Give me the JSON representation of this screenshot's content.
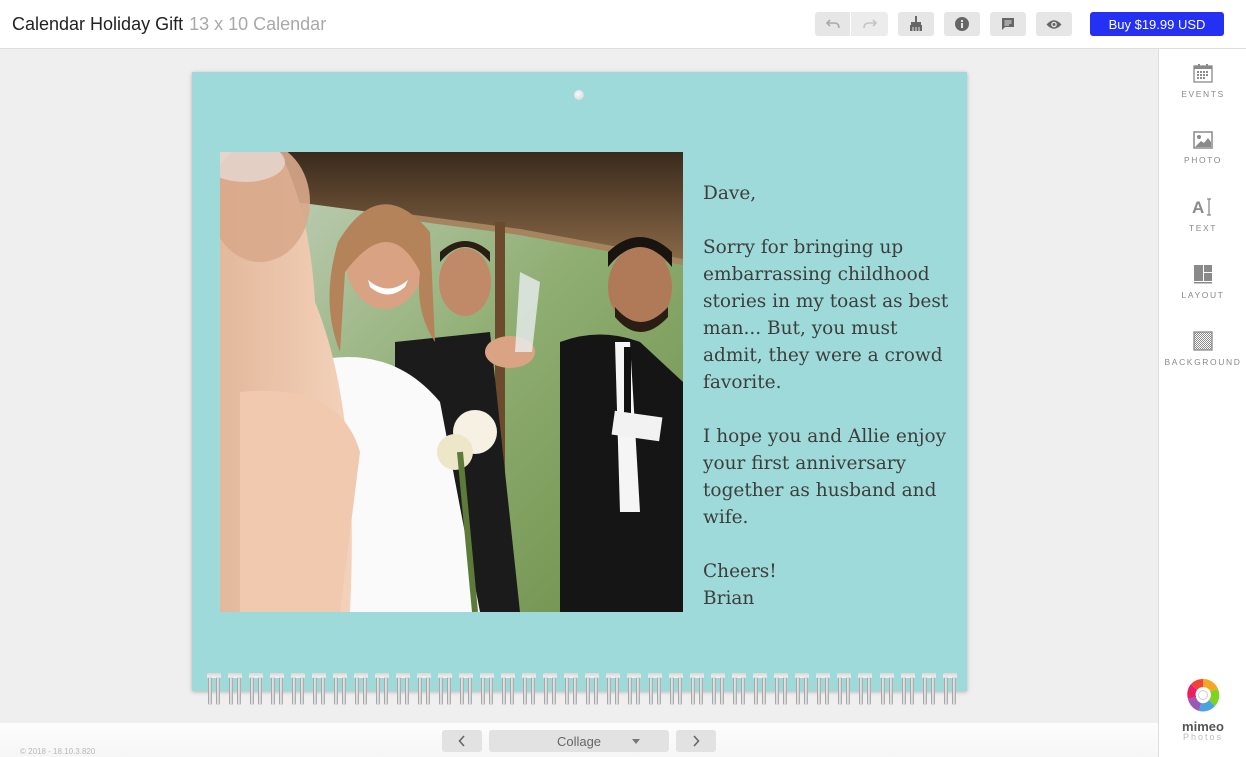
{
  "header": {
    "title": "Calendar Holiday Gift",
    "subtitle": "13 x 10 Calendar",
    "toolbar": {
      "undo_icon": "undo-icon",
      "redo_icon": "redo-icon",
      "clean_icon": "brush-icon",
      "info_icon": "info-icon",
      "comment_icon": "comment-icon",
      "preview_icon": "eye-icon"
    },
    "buy_label": "Buy $19.99 USD",
    "buy_color": "#2431f5"
  },
  "page": {
    "background_color": "#9edada",
    "photo_description": "Wedding toast: bride smiling holding a champagne glass beside groom and best man under a pergola",
    "message": {
      "greeting": "Dave,",
      "paragraph1": "Sorry for bringing up embarrassing childhood stories in my toast as best man... But, you must admit, they were a crowd favorite.",
      "paragraph2": "I hope you and Allie enjoy your first anniversary together as husband and wife.",
      "closing": "Cheers!",
      "signature": "Brian"
    }
  },
  "sidebar": {
    "items": [
      {
        "label": "EVENTS",
        "icon": "calendar-icon"
      },
      {
        "label": "PHOTO",
        "icon": "photo-icon"
      },
      {
        "label": "TEXT",
        "icon": "text-icon"
      },
      {
        "label": "LAYOUT",
        "icon": "layout-icon"
      },
      {
        "label": "BACKGROUND",
        "icon": "background-icon"
      }
    ],
    "logo": {
      "name": "mimeo",
      "tagline": "Photos"
    }
  },
  "footer": {
    "copyright": "© 2018 - 18.10.3.820",
    "layout_select": "Collage",
    "prev_icon": "chevron-left-icon",
    "next_icon": "chevron-right-icon"
  }
}
